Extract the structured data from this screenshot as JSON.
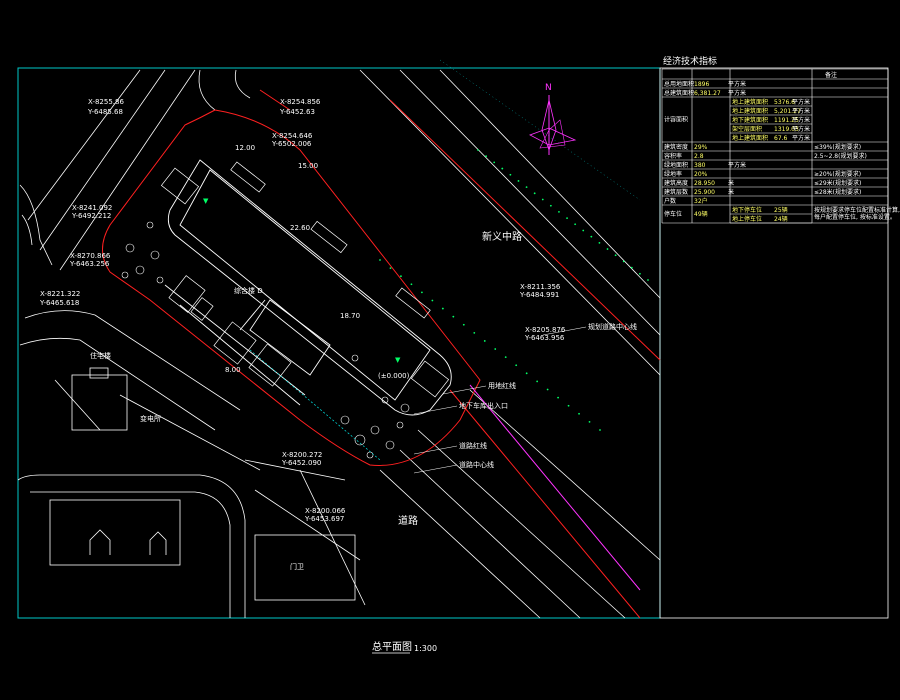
{
  "drawing": {
    "caption": "总平面图",
    "scale": "1:300",
    "colors": {
      "background": "#000000",
      "border": "#00c8c8",
      "red_line": "#ff2020",
      "white_line": "#ffffff",
      "green_marks": "#00ff66",
      "magenta": "#ff33ff",
      "cyan": "#00e5e5",
      "yellow": "#ffff00"
    },
    "compass": {
      "north_label": "N"
    },
    "roads": {
      "main_road": "新义中路",
      "south_road": "道路"
    },
    "building_label": "综合楼 D",
    "elevation_marker": "(±0.000)",
    "coordinates": [
      "X-8255.86",
      "Y-6485.68",
      "X-8254.856",
      "Y-6452.63",
      "X-8254.646",
      "Y-6502.006",
      "X-8241.092",
      "Y-6492.212",
      "X-8270.866",
      "Y-6463.256",
      "X-8221.322",
      "Y-6465.618",
      "X-8211.356",
      "Y-6484.991",
      "X-8205.876",
      "Y-6463.956",
      "X-8200.272",
      "Y-6452.090",
      "X-8200.066",
      "Y-6453.697"
    ],
    "callouts": [
      "规划道路中心线",
      "地下车库出入口",
      "道路红线",
      "道路中心线",
      "用地红线"
    ],
    "side_labels": [
      "住宅楼",
      "变电所",
      "门卫"
    ],
    "dims": [
      "12.00",
      "15.00",
      "22.60",
      "18.70",
      "8.00"
    ]
  },
  "table": {
    "title": "经济技术指标",
    "header_right": "备注",
    "rows": [
      {
        "label": "总用地面积",
        "value": "1896",
        "unit": "平方米",
        "note": ""
      },
      {
        "label": "总建筑面积",
        "value": "6,381.27",
        "unit": "平方米",
        "note": ""
      },
      {
        "label": "计容面积",
        "value": "",
        "unit": "",
        "note": "",
        "sub": [
          {
            "label": "地上建筑面积",
            "value": "5376.6",
            "unit": "平方米"
          },
          {
            "label": "地上建筑面积",
            "value": "5,201.27",
            "unit": "平方米"
          },
          {
            "label": "地下建筑面积",
            "value": "1191.25",
            "unit": "平方米"
          },
          {
            "label": "架空层面积",
            "value": "1319.03",
            "unit": "平方米"
          },
          {
            "label": "地上建筑面积",
            "value": "67.6",
            "unit": "平方米"
          }
        ]
      },
      {
        "label": "建筑密度",
        "value": "29%",
        "unit": "",
        "note": "≤39%(规划要求)"
      },
      {
        "label": "容积率",
        "value": "2.8",
        "unit": "",
        "note": "2.5~2.8(规划要求)"
      },
      {
        "label": "绿地面积",
        "value": "380",
        "unit": "平方米",
        "note": ""
      },
      {
        "label": "绿地率",
        "value": "20%",
        "unit": "",
        "note": "≥20%(规划要求)"
      },
      {
        "label": "建筑高度",
        "value": "28.950",
        "unit": "米",
        "note": "≤29米(规划要求)"
      },
      {
        "label": "建筑层数",
        "value": "25.900",
        "unit": "米",
        "note": "≤28米(规划要求)"
      },
      {
        "label": "户数",
        "value": "32户",
        "unit": "",
        "note": ""
      },
      {
        "label": "停车位",
        "value": "49辆",
        "unit": "",
        "note": "",
        "sub": [
          {
            "label": "地下停车位",
            "value": "25辆",
            "unit": ""
          },
          {
            "label": "地上停车位",
            "value": "24辆",
            "unit": ""
          }
        ],
        "remark": "按规划要求停车位配置标准计算, 地下停车位按每户配置停车位, 按标准设置。"
      }
    ]
  }
}
